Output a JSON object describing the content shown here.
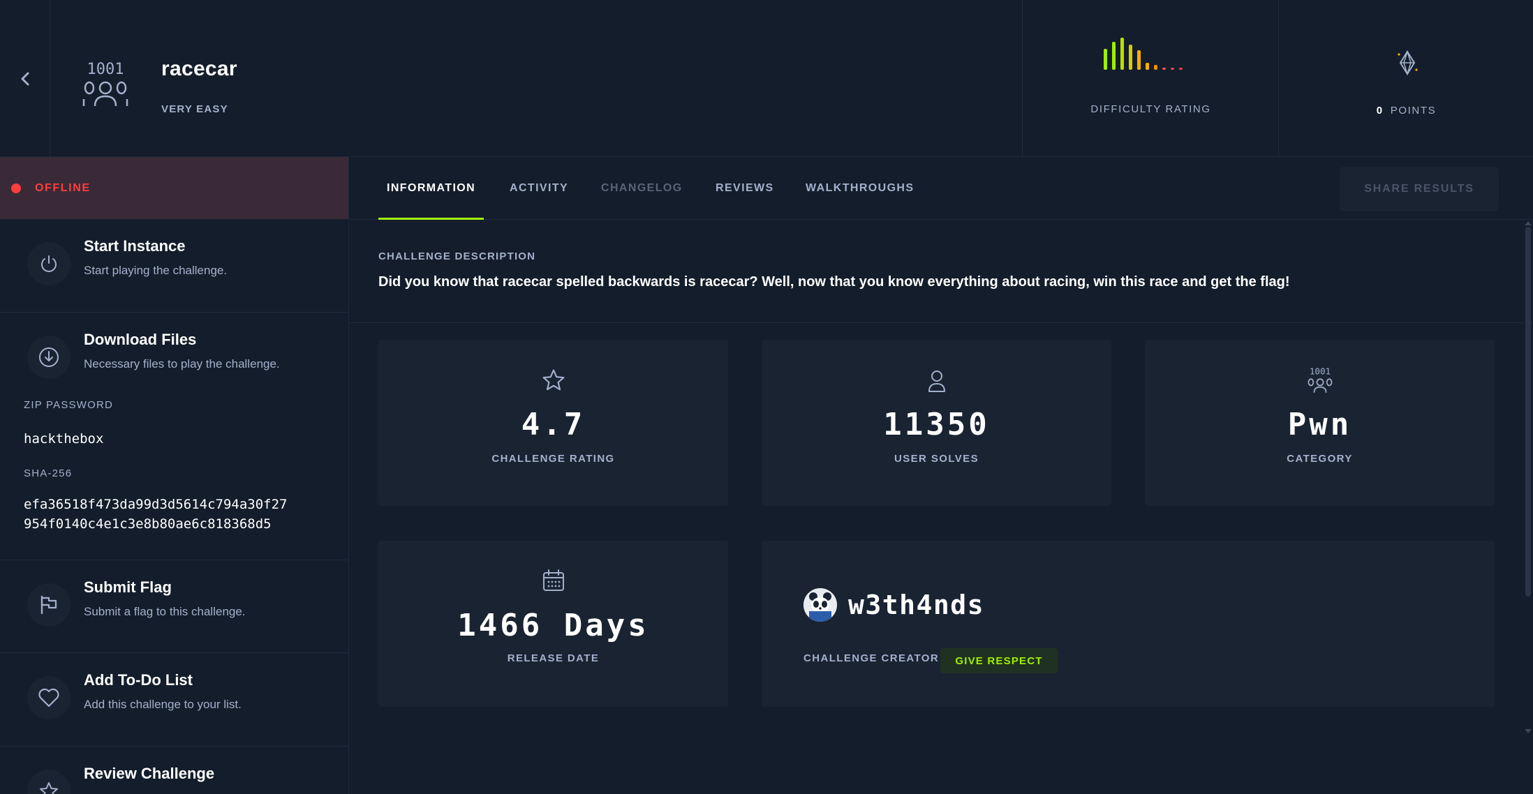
{
  "header": {
    "title": "racecar",
    "difficulty": "VERY EASY",
    "difficulty_rating_label": "DIFFICULTY RATING",
    "points_value": "0",
    "points_label": "POINTS",
    "icons": {
      "back": "chevron-left-icon",
      "category": "binary-user-icon",
      "points": "diamond-icon"
    }
  },
  "difficulty_bars": {
    "colors": [
      "#9fef00",
      "#9fef00",
      "#b8e000",
      "#d6d000",
      "#ffaf00",
      "#ffaf00",
      "#ff8c00",
      "#ff5555",
      "#ff3e3e",
      "#ff3e3e"
    ]
  },
  "sidebar": {
    "status": "OFFLINE",
    "status_color": "#ff3e3e",
    "actions": [
      {
        "title": "Start Instance",
        "subtitle": "Start playing the challenge.",
        "icon": "power-icon"
      },
      {
        "title": "Download Files",
        "subtitle": "Necessary files to play the challenge.",
        "icon": "download-icon"
      },
      {
        "title": "Submit Flag",
        "subtitle": "Submit a flag to this challenge.",
        "icon": "flag-icon"
      },
      {
        "title": "Add To-Do List",
        "subtitle": "Add this challenge to your list.",
        "icon": "heart-icon"
      },
      {
        "title": "Review Challenge",
        "subtitle": "",
        "icon": "star-icon"
      }
    ],
    "zip_password_label": "ZIP PASSWORD",
    "zip_password": "hackthebox",
    "sha_label": "SHA-256",
    "sha_line1": "efa36518f473da99d3d5614c794a30f27",
    "sha_line2": "954f0140c4e1c3e8b80ae6c818368d5"
  },
  "tabs": [
    {
      "label": "INFORMATION",
      "state": "active"
    },
    {
      "label": "ACTIVITY",
      "state": "normal"
    },
    {
      "label": "CHANGELOG",
      "state": "disabled"
    },
    {
      "label": "REVIEWS",
      "state": "normal"
    },
    {
      "label": "WALKTHROUGHS",
      "state": "normal"
    }
  ],
  "share_button": "SHARE RESULTS",
  "description": {
    "label": "CHALLENGE DESCRIPTION",
    "text": "Did you know that racecar spelled backwards is racecar? Well, now that you know everything about racing, win this race and get the flag!"
  },
  "stats": {
    "rating": {
      "value": "4.7",
      "label": "CHALLENGE RATING",
      "icon": "star-icon"
    },
    "solves": {
      "value": "11350",
      "label": "USER SOLVES",
      "icon": "user-icon"
    },
    "category": {
      "value": "Pwn",
      "label": "CATEGORY",
      "icon": "binary-user-icon"
    },
    "release": {
      "value": "1466 Days",
      "label": "RELEASE DATE",
      "icon": "calendar-icon"
    }
  },
  "creator": {
    "name": "w3th4nds",
    "label": "CHALLENGE CREATOR",
    "respect_button": "GIVE RESPECT"
  },
  "colors": {
    "background": "#141d2b",
    "card": "#1a2332",
    "accent": "#9fef00",
    "muted": "#a4b1cd",
    "offline": "#ff3e3e"
  }
}
